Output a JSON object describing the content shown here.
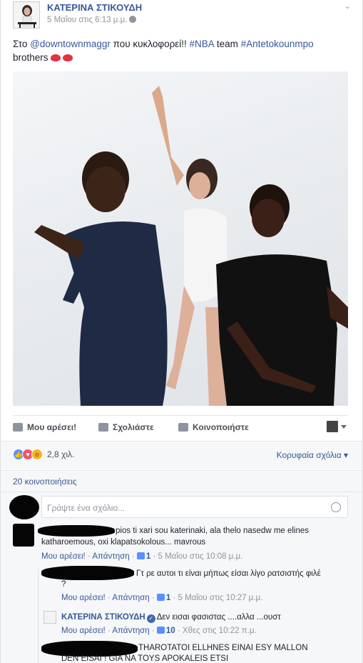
{
  "post": {
    "author": "ΚΑΤΕΡΙΝΑ ΣΤΙΚΟΥΔΗ",
    "timestamp": "5 Μαΐου στις 6:13 μ.μ.",
    "text_prefix": "Στο ",
    "mention": "@downtownmaggr",
    "text_mid": " που κυκλοφορεί!! ",
    "hashtag1": "#NBA",
    "text_mid2": " team ",
    "hashtag2": "#Antetokounmpo",
    "text_suffix": "brothers"
  },
  "actions": {
    "like": "Μου αρέσει!",
    "comment": "Σχολιάστε",
    "share": "Κοινοποιήστε"
  },
  "reactions": {
    "count": "2,8 χιλ.",
    "top_comments": "Κορυφαία σχόλια"
  },
  "shares": "20 κοινοποιήσεις",
  "composer": {
    "placeholder": "Γράψτε ένα σχόλιο..."
  },
  "comments": [
    {
      "text1": "pios ti xari sou katerinaki, ala thelo nasedw me elines",
      "text2": "katharoemous, oxi klapatsokolous... mavrous",
      "like": "Μου αρέσει!",
      "reply": "Απάντηση",
      "likes": "1",
      "time": "5 Μαΐου στις 10:08 μ.μ."
    },
    {
      "text1": "Γτ ρε αυτοι τι είναι μήπως είσαι λίγο ρατσιστής φιλέ",
      "text2": "?",
      "like": "Μου αρέσει!",
      "reply": "Απάντηση",
      "likes": "1",
      "time": "5 Μαΐου στις 10:27 μ.μ."
    },
    {
      "author": "ΚΑΤΕΡΙΝΑ ΣΤΙΚΟΥΔΗ",
      "text1": "Δεν εισαι φασιστας ....αλλα ...ουστ",
      "like": "Μου αρέσει!",
      "reply": "Απάντηση",
      "likes": "10",
      "time": "Χθες στις 10:22 π.μ."
    },
    {
      "text1": "THAROTATOI ELLHNES EINAI ESY MALLON",
      "text2": "DEN EISAI ! GIA NA TOYS APOKALEIS ETSI"
    }
  ],
  "colors": {
    "link": "#365899",
    "meta": "#90949c",
    "background": "#f6f7f9"
  }
}
